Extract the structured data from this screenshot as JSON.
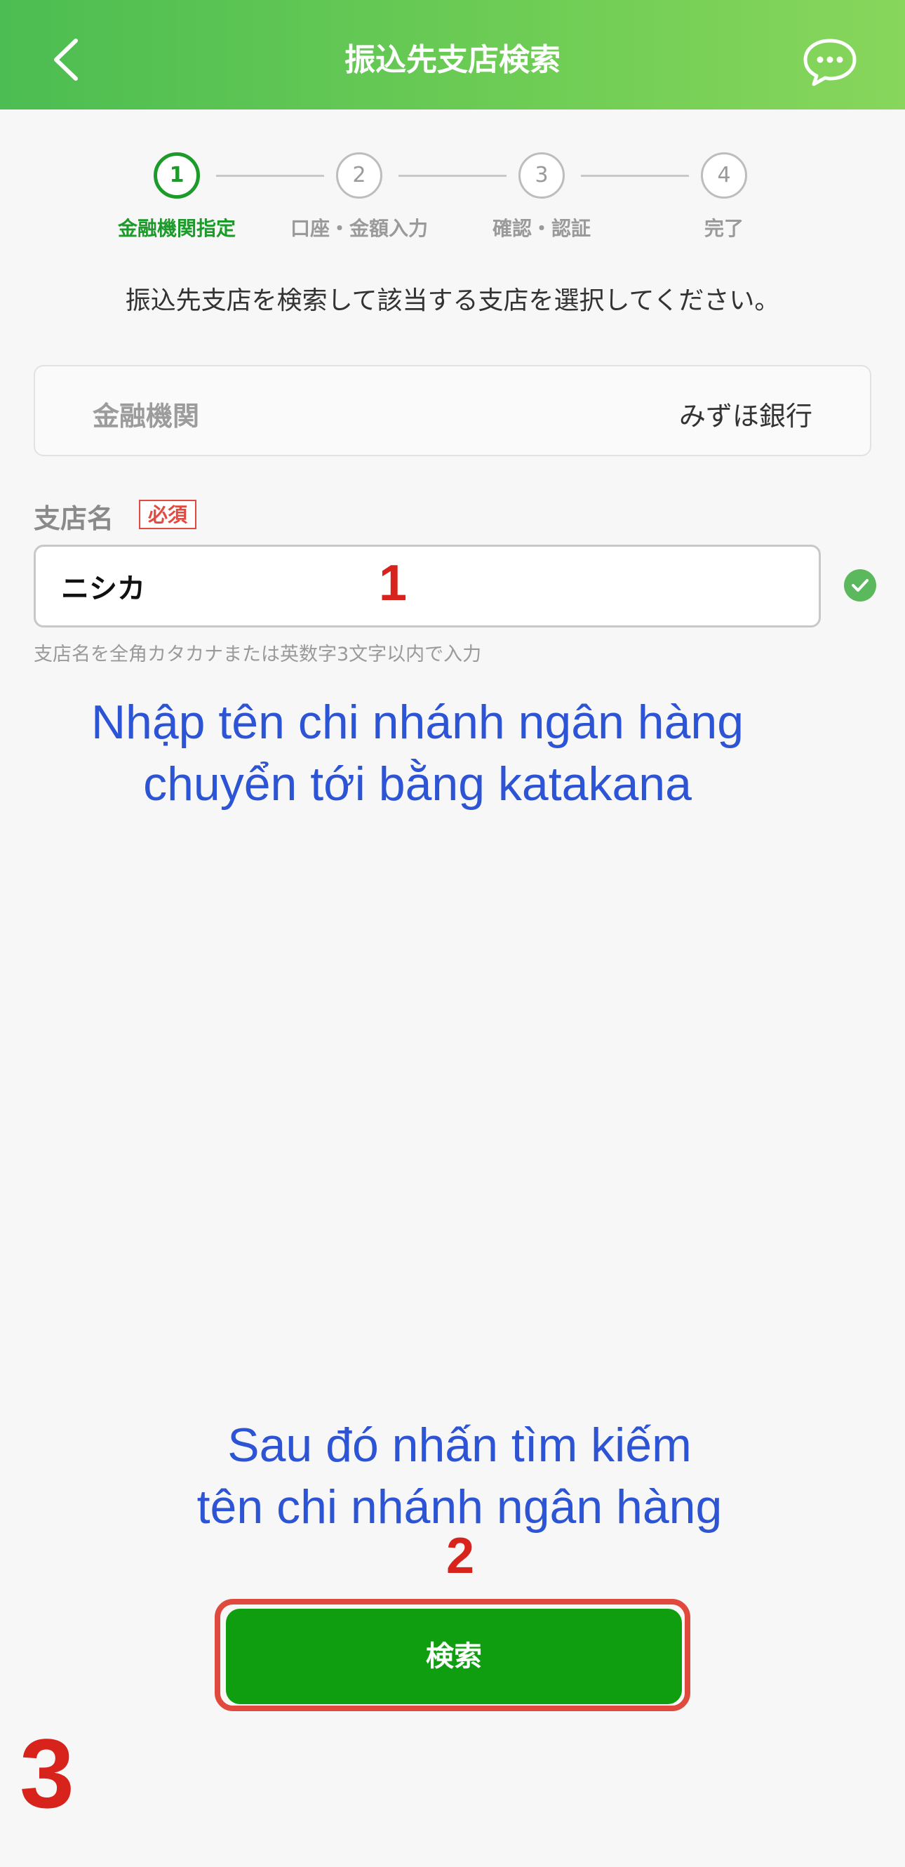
{
  "header": {
    "title": "振込先支店検索",
    "back_icon": "chevron-left-icon",
    "chat_icon": "chat-bubble-icon",
    "gradient_colors": [
      "#4cbd52",
      "#88d65c"
    ]
  },
  "stepper": {
    "steps": [
      {
        "number": "1",
        "label": "金融機関指定",
        "active": true
      },
      {
        "number": "2",
        "label": "口座・金額入力",
        "active": false
      },
      {
        "number": "3",
        "label": "確認・認証",
        "active": false
      },
      {
        "number": "4",
        "label": "完了",
        "active": false
      }
    ],
    "active_color": "#1c9a2a"
  },
  "instruction": "振込先支店を検索して該当する支店を選択してください。",
  "bank": {
    "label": "金融機関",
    "value": "みずほ銀行"
  },
  "branch_field": {
    "label": "支店名",
    "required_badge": "必須",
    "value": "ニシカ",
    "hint": "支店名を全角カタカナまたは英数字3文字以内で入力",
    "valid_icon": "check-circle-icon"
  },
  "annotations": {
    "step1_number": "1",
    "step1_text_line1": "Nhập tên chi nhánh ngân hàng",
    "step1_text_line2": "chuyển tới bằng katakana",
    "step2_text_line1": "Sau đó nhấn tìm kiếm",
    "step2_text_line2": "tên chi nhánh ngân hàng",
    "step2_number": "2",
    "step3_number": "3",
    "text_color": "#2c54d4",
    "number_color": "#d8231c"
  },
  "search_button": {
    "label": "検索",
    "color": "#0f9e10"
  }
}
